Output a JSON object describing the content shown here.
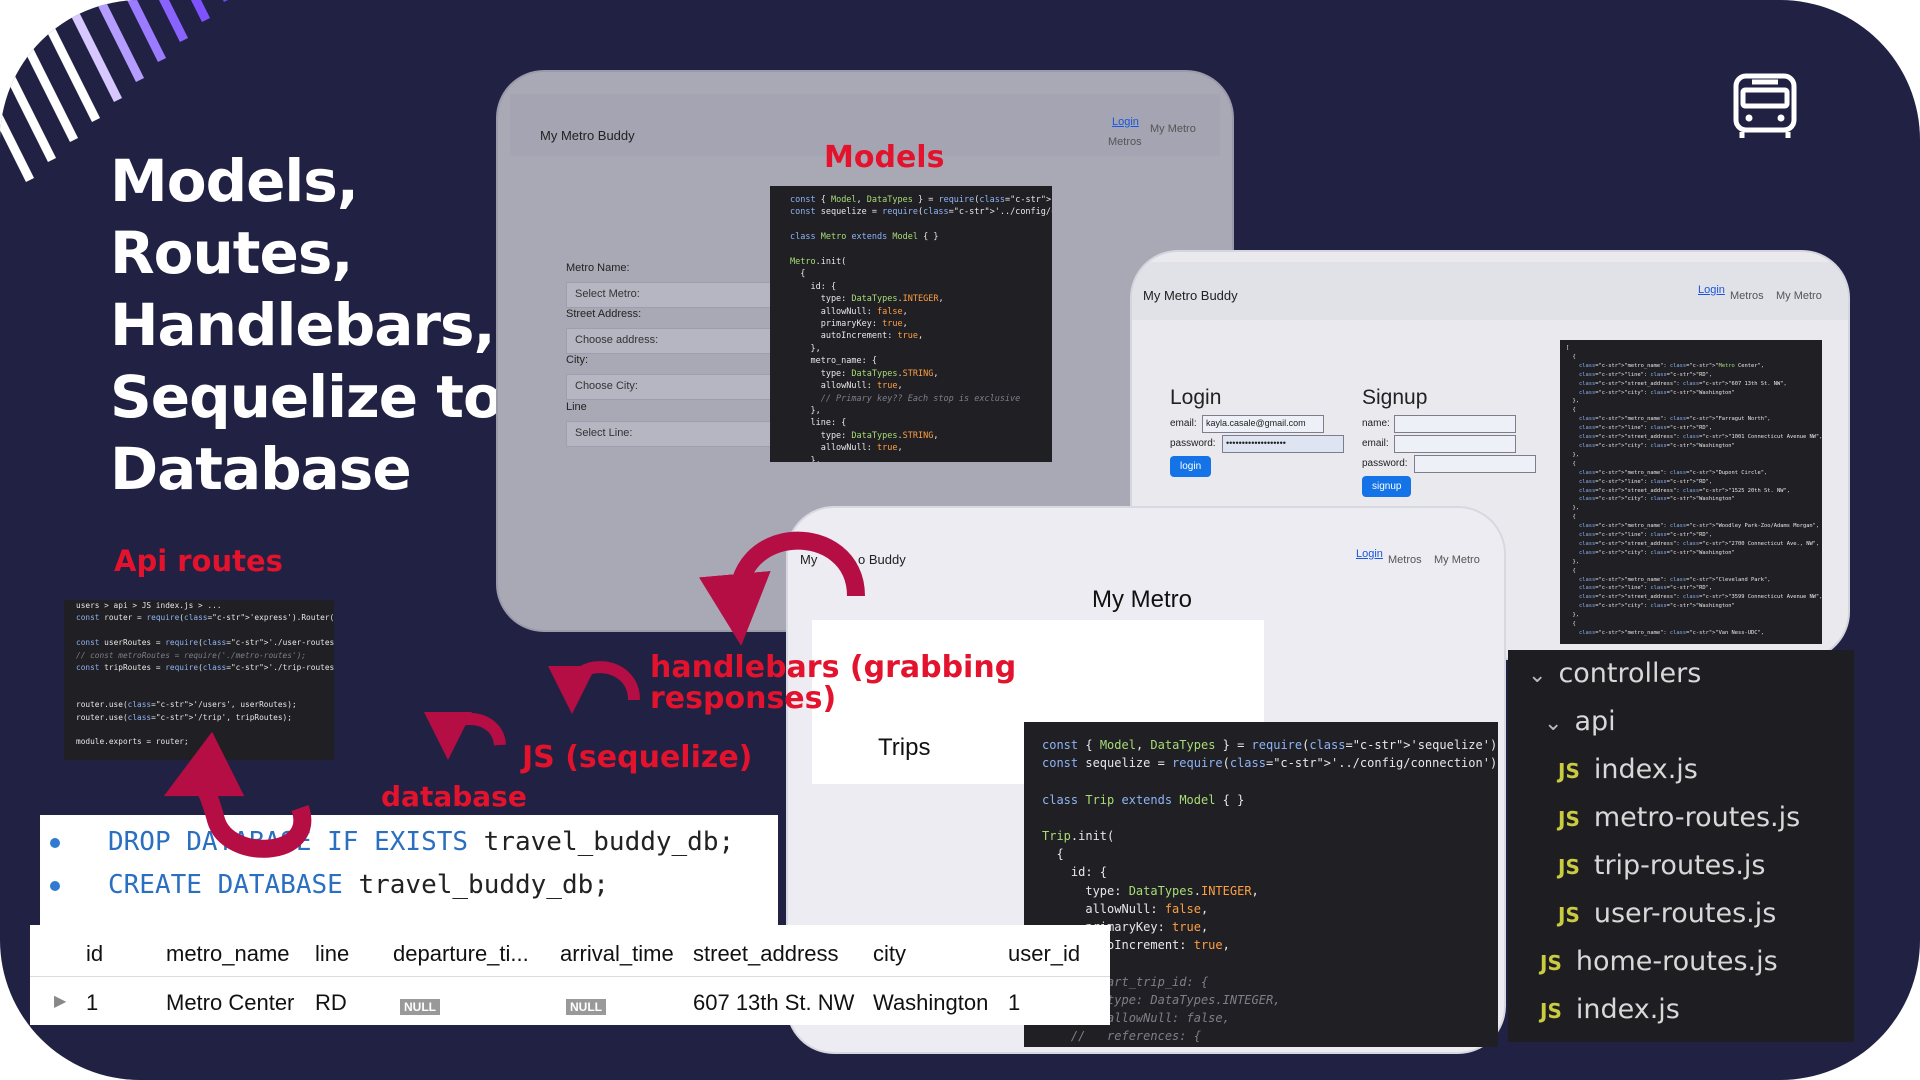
{
  "slide": {
    "title_lines": [
      "Models,",
      "Routes,",
      "Handlebars,",
      "Sequelize to",
      "Database"
    ],
    "bus_icon": "bus-icon"
  },
  "labels": {
    "models": "Models",
    "api_routes": "Api routes",
    "handlebars": "handlebars  (grabbing",
    "handlebars_2": "responses)",
    "js_sequelize": "JS (sequelize)",
    "database": "database"
  },
  "window_metro": {
    "brand": "My Metro Buddy",
    "nav": {
      "login": "Login",
      "my_metro": "My Metro",
      "metros": "Metros"
    },
    "form": {
      "metro_name_label": "Metro Name:",
      "metro_select": "Select Metro:",
      "street_label": "Street Address:",
      "street_select": "Choose address:",
      "city_label": "City:",
      "city_select": "Choose City:",
      "line_label": "Line",
      "line_select": "Select Line:"
    }
  },
  "window_login": {
    "brand": "My Metro Buddy",
    "nav": {
      "login": "Login",
      "metros": "Metros",
      "my_metro": "My Metro"
    },
    "login": {
      "heading": "Login",
      "email_label": "email:",
      "email_value": "kayla.casale@gmail.com",
      "password_label": "password:",
      "password_value": "•••••••••••••••••••",
      "button": "login"
    },
    "signup": {
      "heading": "Signup",
      "name_label": "name:",
      "email_label": "email:",
      "password_label": "password:",
      "button": "signup"
    }
  },
  "window_trips": {
    "brand_left": "My",
    "brand_right": "o Buddy",
    "nav": {
      "login": "Login",
      "metros": "Metros",
      "my_metro": "My Metro"
    },
    "heading": "My Metro",
    "trips": "Trips"
  },
  "code_models": [
    "const { Model, DataTypes } = require('sequelize');",
    "const sequelize = require('../config/connection');",
    "",
    "class Metro extends Model { }",
    "",
    "Metro.init(",
    "  {",
    "    id: {",
    "      type: DataTypes.INTEGER,",
    "      allowNull: false,",
    "      primaryKey: true,",
    "      autoIncrement: true,",
    "    },",
    "    metro_name: {",
    "      type: DataTypes.STRING,",
    "      allowNull: true,",
    "      // Primary key?? Each stop is exclusive",
    "    },",
    "    line: {",
    "      type: DataTypes.STRING,",
    "      allowNull: true,",
    "    },"
  ],
  "code_trip": [
    "const { Model, DataTypes } = require('sequelize');",
    "const sequelize = require('../config/connection');",
    "",
    "class Trip extends Model { }",
    "",
    "Trip.init(",
    "  {",
    "    id: {",
    "      type: DataTypes.INTEGER,",
    "      allowNull: false,",
    "      primaryKey: true,",
    "      autoIncrement: true,",
    "    },",
    "    // start_trip_id: {",
    "    //   type: DataTypes.INTEGER,",
    "    //   allowNull: false,",
    "    //   references: {"
  ],
  "code_api": [
    "users > api > JS index.js > ...",
    "const router = require('express').Router();",
    "",
    "const userRoutes = require('./user-routes');",
    "// const metroRoutes = require('./metro-routes');",
    "const tripRoutes = require('./trip-routes')",
    "",
    "",
    "router.use('/users', userRoutes);",
    "router.use('/trip', tripRoutes);",
    "",
    "module.exports = router;"
  ],
  "code_json": [
    "[",
    "  {",
    "    \"metro_name\": \"Metro Center\",",
    "    \"line\": \"RD\",",
    "    \"street_address\": \"607 13th St. NW\",",
    "    \"city\": \"Washington\"",
    "  },",
    "  {",
    "    \"metro_name\": \"Farragut North\",",
    "    \"line\": \"RD\",",
    "    \"street_address\": \"1001 Connecticut Avenue NW\",",
    "    \"city\": \"Washington\"",
    "  },",
    "  {",
    "    \"metro_name\": \"Dupont Circle\",",
    "    \"line\": \"RD\",",
    "    \"street_address\": \"1525 20th St. NW\",",
    "    \"city\": \"Washington\"",
    "  },",
    "  {",
    "    \"metro_name\": \"Woodley Park-Zoo/Adams Morgan\",",
    "    \"line\": \"RD\",",
    "    \"street_address\": \"2700 Connecticut Ave., NW\",",
    "    \"city\": \"Washington\"",
    "  },",
    "  {",
    "    \"metro_name\": \"Cleveland Park\",",
    "    \"line\": \"RD\",",
    "    \"street_address\": \"3599 Connecticut Avenue NW\",",
    "    \"city\": \"Washington\"",
    "  },",
    "  {",
    "    \"metro_name\": \"Van Ness-UDC\","
  ],
  "file_tree": {
    "controllers": "controllers",
    "api": "api",
    "files_api": [
      "index.js",
      "metro-routes.js",
      "trip-routes.js",
      "user-routes.js"
    ],
    "files_root": [
      "home-routes.js",
      "index.js"
    ],
    "js_badge": "JS"
  },
  "sql": {
    "line1_kw1": "DROP DATABASE IF EXISTS",
    "line1_rest": " travel_buddy_db;",
    "line2_kw": "CREATE DATABASE",
    "line2_rest": " travel_buddy_db;"
  },
  "table": {
    "headers": [
      "id",
      "metro_name",
      "line",
      "departure_ti...",
      "arrival_time",
      "street_address",
      "city",
      "user_id"
    ],
    "row": [
      "1",
      "Metro Center",
      "RD",
      "NULL",
      "NULL",
      "607 13th St. NW",
      "Washington",
      "1"
    ],
    "row_marker": "▶"
  },
  "colors": {
    "background": "#212143",
    "accent_red": "#e3122d",
    "arrow": "#b40e45"
  }
}
